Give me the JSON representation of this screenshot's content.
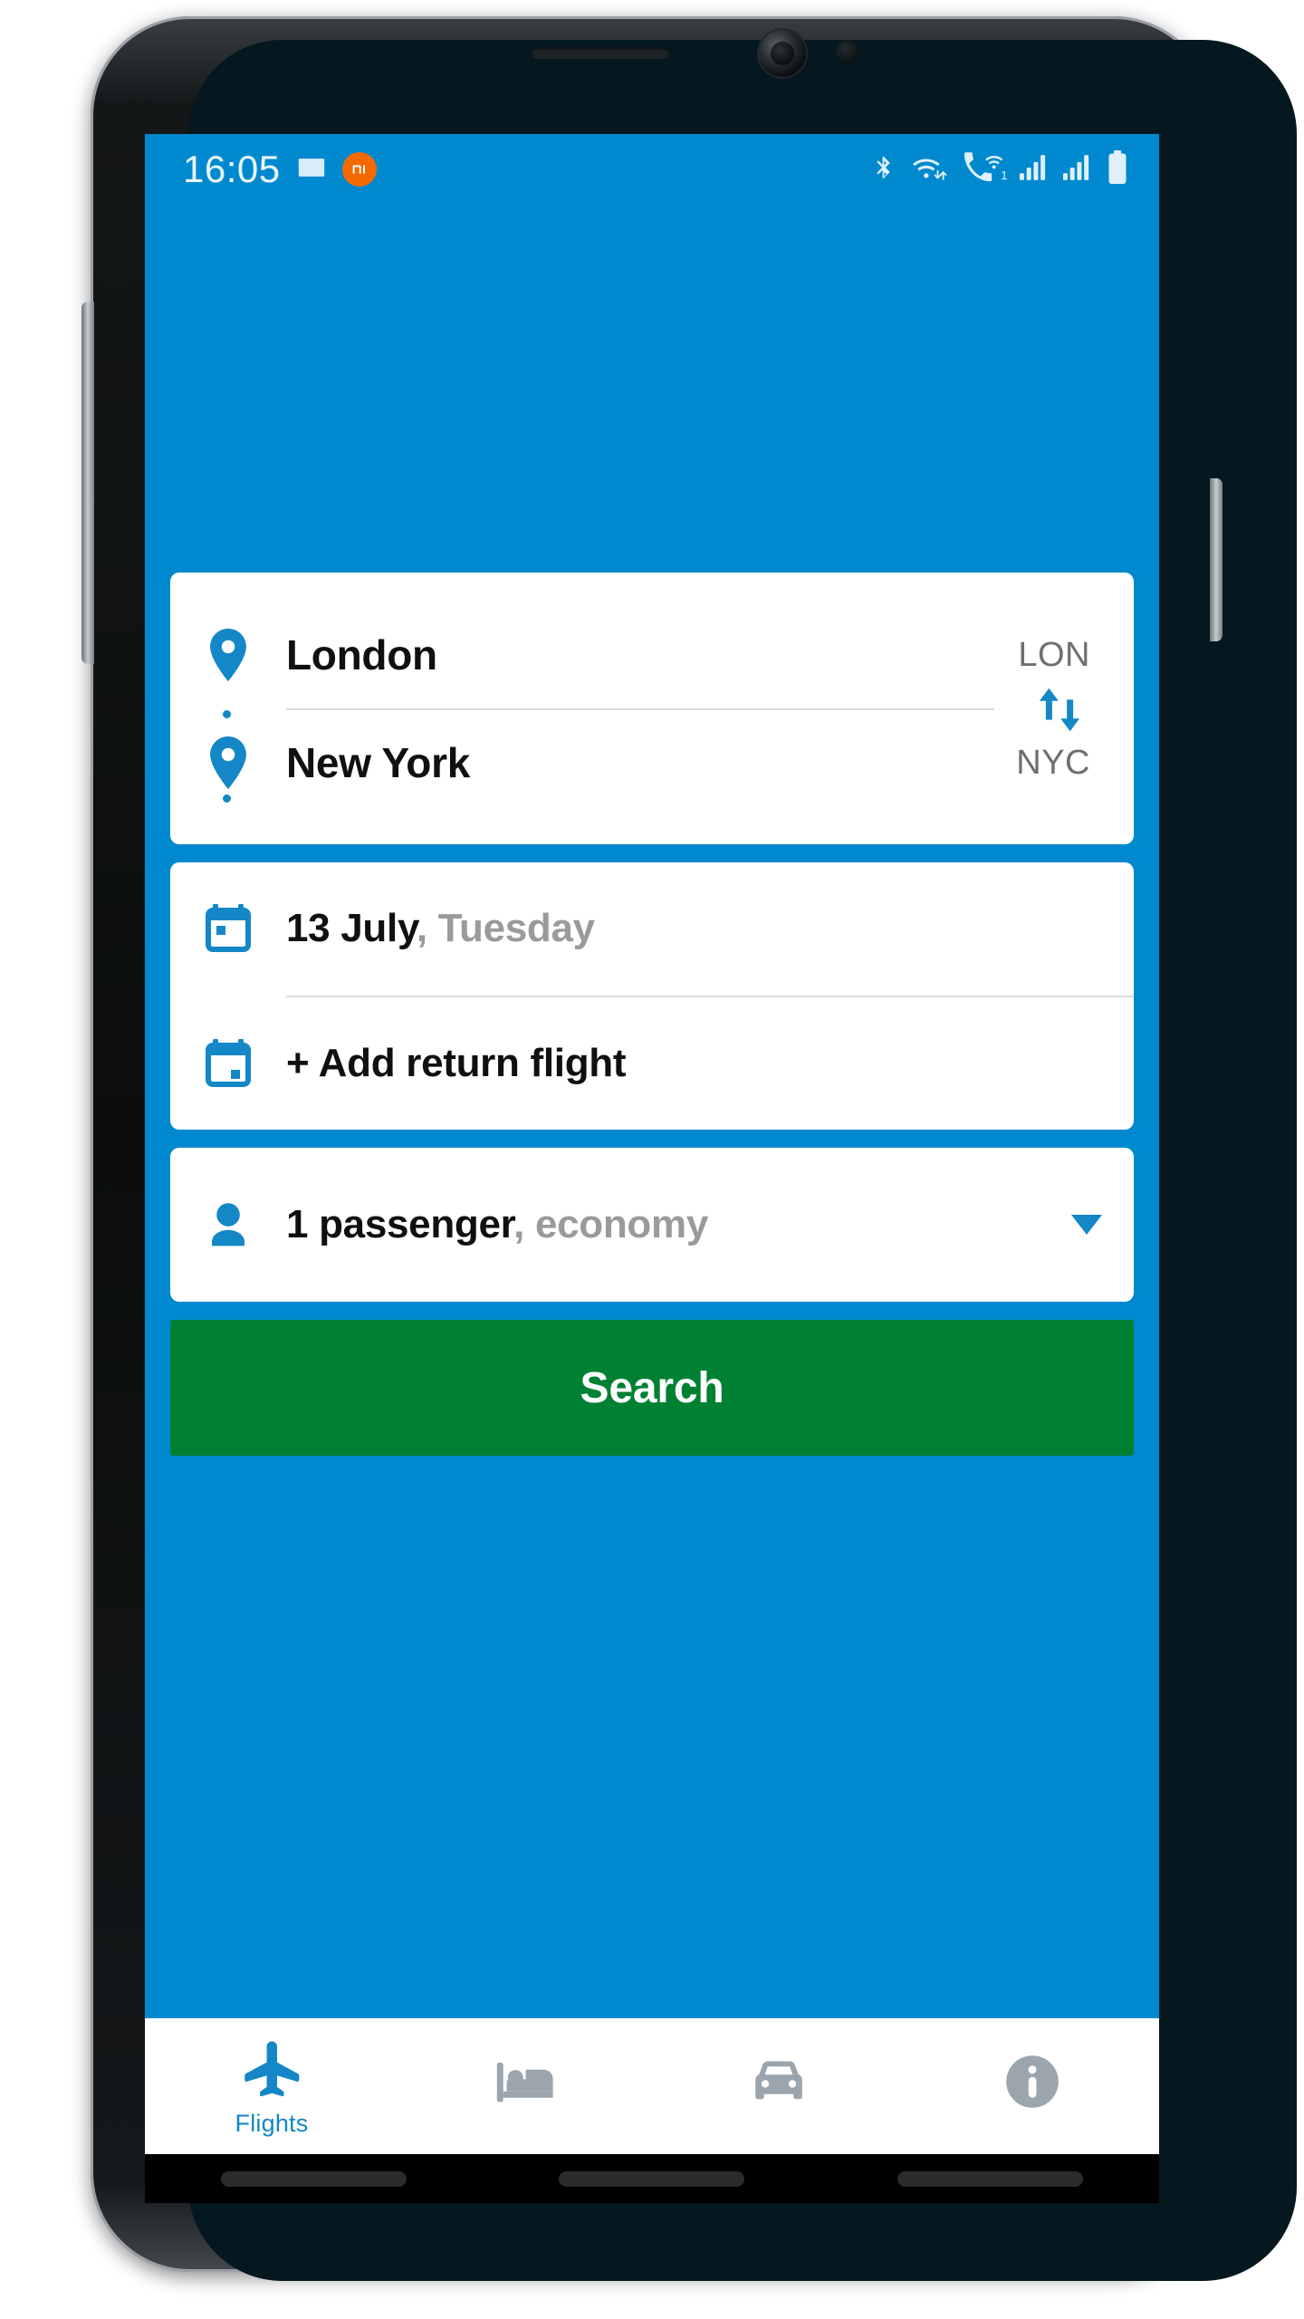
{
  "status_bar": {
    "time": "16:05",
    "left_icons": [
      "gallery-icon",
      "mi-app-badge"
    ],
    "mi_badge_text": "mi",
    "right_icons": [
      "bluetooth-icon",
      "wifi-icon",
      "wifi-calling-icon",
      "signal-sim1-icon",
      "signal-sim2-icon",
      "battery-icon"
    ],
    "sim_indicator": "1"
  },
  "route": {
    "origin": {
      "city": "London",
      "code": "LON"
    },
    "destination": {
      "city": "New York",
      "code": "NYC"
    },
    "swap_icon": "swap-vertical-icon"
  },
  "dates": {
    "depart": {
      "day_month": "13 July",
      "separator": ",",
      "weekday": " Tuesday"
    },
    "return": {
      "label": "+ Add return flight"
    }
  },
  "passenger": {
    "count_label": "1 passenger",
    "separator": ",",
    "cabin_class": " economy",
    "caret_icon": "chevron-down-icon"
  },
  "actions": {
    "search_label": "Search"
  },
  "bottom_nav": {
    "items": [
      {
        "label": "Flights",
        "icon": "airplane-icon",
        "active": true
      },
      {
        "label": "",
        "icon": "hotel-bed-icon",
        "active": false
      },
      {
        "label": "",
        "icon": "car-rental-icon",
        "active": false
      },
      {
        "label": "",
        "icon": "info-circle-icon",
        "active": false
      }
    ]
  },
  "colors": {
    "brand_blue": "#0089CE",
    "icon_blue": "#1487C6",
    "search_green": "#008033",
    "card_white": "#FFFFFF",
    "muted_gray": "#9A9A9A",
    "code_gray": "#6F6F6F",
    "nav_inactive_gray": "#9AA5AE",
    "mi_orange": "#F56A00"
  }
}
